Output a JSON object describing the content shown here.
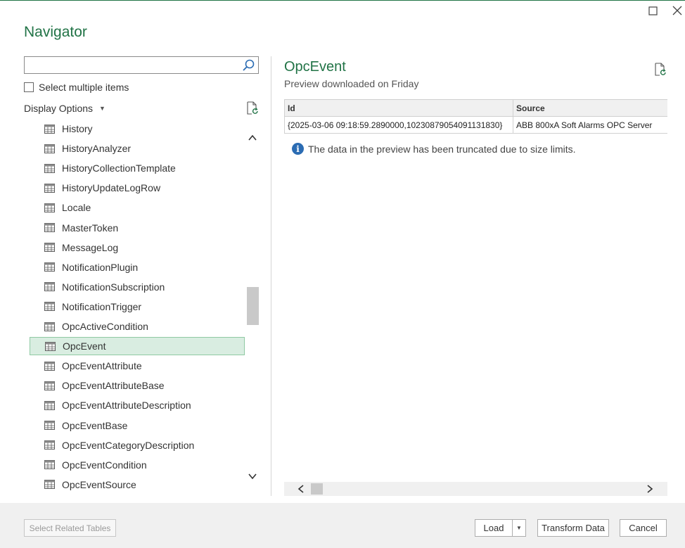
{
  "window": {
    "title": "Navigator"
  },
  "search": {
    "placeholder": "",
    "value": ""
  },
  "select_multiple": {
    "label": "Select multiple items",
    "checked": false
  },
  "display_options": {
    "label": "Display Options"
  },
  "tree": {
    "items": [
      {
        "label": "History",
        "selected": false
      },
      {
        "label": "HistoryAnalyzer",
        "selected": false
      },
      {
        "label": "HistoryCollectionTemplate",
        "selected": false
      },
      {
        "label": "HistoryUpdateLogRow",
        "selected": false
      },
      {
        "label": "Locale",
        "selected": false
      },
      {
        "label": "MasterToken",
        "selected": false
      },
      {
        "label": "MessageLog",
        "selected": false
      },
      {
        "label": "NotificationPlugin",
        "selected": false
      },
      {
        "label": "NotificationSubscription",
        "selected": false
      },
      {
        "label": "NotificationTrigger",
        "selected": false
      },
      {
        "label": "OpcActiveCondition",
        "selected": false
      },
      {
        "label": "OpcEvent",
        "selected": true
      },
      {
        "label": "OpcEventAttribute",
        "selected": false
      },
      {
        "label": "OpcEventAttributeBase",
        "selected": false
      },
      {
        "label": "OpcEventAttributeDescription",
        "selected": false
      },
      {
        "label": "OpcEventBase",
        "selected": false
      },
      {
        "label": "OpcEventCategoryDescription",
        "selected": false
      },
      {
        "label": "OpcEventCondition",
        "selected": false
      },
      {
        "label": "OpcEventSource",
        "selected": false
      }
    ]
  },
  "preview": {
    "title": "OpcEvent",
    "subtitle": "Preview downloaded on Friday",
    "columns": [
      "Id",
      "Source"
    ],
    "rows": [
      [
        "{2025-03-06 09:18:59.2890000,10230879054091131830}",
        "ABB 800xA Soft Alarms OPC Server"
      ]
    ],
    "info_message": "The data in the preview has been truncated due to size limits."
  },
  "footer": {
    "select_related_label": "Select Related Tables",
    "load_label": "Load",
    "transform_label": "Transform Data",
    "cancel_label": "Cancel"
  },
  "colors": {
    "accent": "#217346",
    "selection_bg": "#d9ede1",
    "info": "#2b6cb3"
  }
}
